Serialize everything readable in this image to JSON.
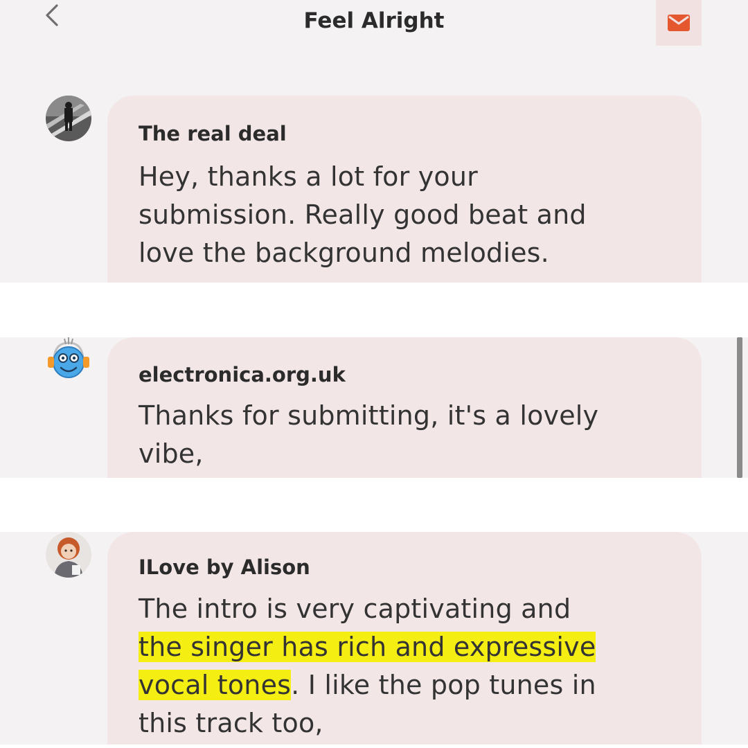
{
  "header": {
    "back_icon": "chevron-left-icon",
    "title": "Feel Alright",
    "mail_icon": "envelope-icon",
    "accent_color": "#e5572f"
  },
  "comments": [
    {
      "author": "The real deal",
      "lines": [
        "Hey, thanks a lot for your",
        "submission. Really good beat and",
        "love the background melodies."
      ]
    },
    {
      "author": "electronica.org.uk",
      "lines": [
        "Thanks for submitting, it's a lovely",
        "vibe,"
      ]
    },
    {
      "author": "ILove by Alison",
      "line1": "The intro is very captivating and",
      "line2_highlight": "the singer has rich and expressive",
      "line3_highlight": "vocal tones",
      "line3_rest": ". I like the pop tunes in",
      "line4": "this track too,"
    }
  ],
  "colors": {
    "bubble": "#f3e6e7",
    "background": "#f4f2f2",
    "highlight": "#f4ee12"
  }
}
